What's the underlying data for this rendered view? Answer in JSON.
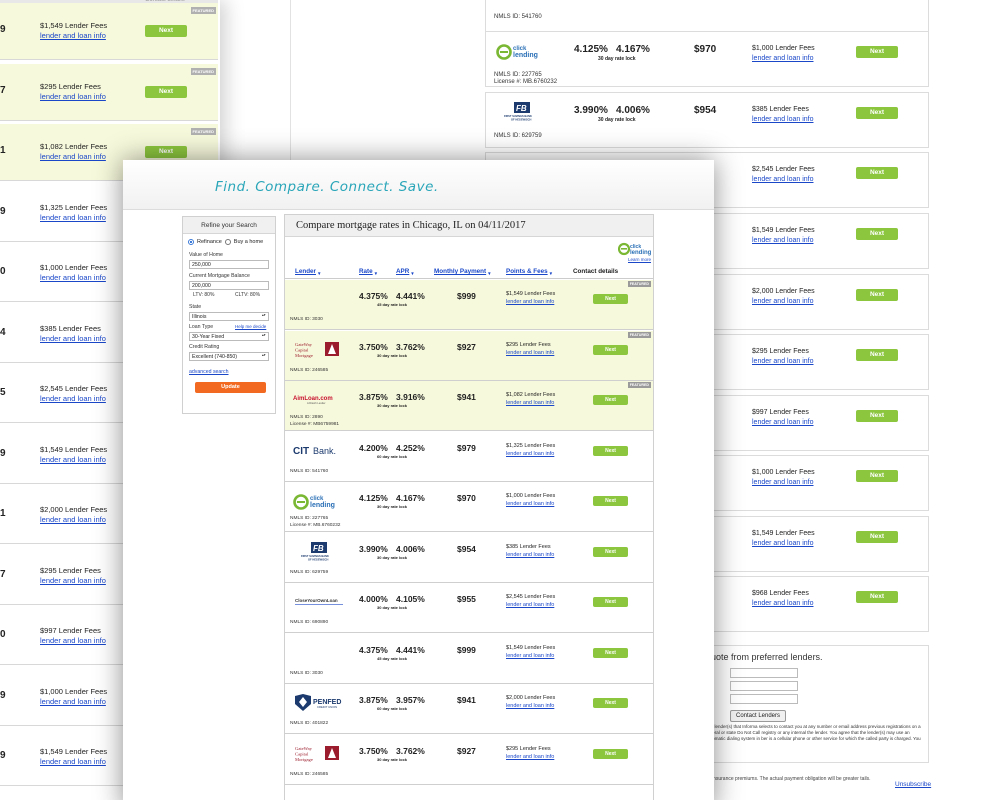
{
  "brand_colors": {
    "teal": "#2aa6b9",
    "green_button": "#8cc63f",
    "orange_button": "#f26a22",
    "link": "#1a47c8",
    "featured_bg": "#f7f9dc"
  },
  "left_page": {
    "rows": [
      {
        "num": "9",
        "fee": "$1,549 Lender Fees",
        "link": "lender and loan info",
        "next": "Next",
        "featured": true
      },
      {
        "num": "7",
        "fee": "$295 Lender Fees",
        "link": "lender and loan info",
        "next": "Next",
        "featured": true
      },
      {
        "num": "1",
        "fee": "$1,082 Lender Fees",
        "link": "lender and loan info",
        "next": "Next",
        "featured": true
      },
      {
        "num": "9",
        "fee": "$1,325 Lender Fees",
        "link": "lender and loan info",
        "next": "",
        "featured": false
      },
      {
        "num": "0",
        "fee": "$1,000 Lender Fees",
        "link": "lender and loan info",
        "next": "",
        "featured": false
      },
      {
        "num": "4",
        "fee": "$385 Lender Fees",
        "link": "lender and loan info",
        "next": "",
        "featured": false
      },
      {
        "num": "5",
        "fee": "$2,545 Lender Fees",
        "link": "lender and loan info",
        "next": "",
        "featured": false
      },
      {
        "num": "9",
        "fee": "$1,549 Lender Fees",
        "link": "lender and loan info",
        "next": "",
        "featured": false
      },
      {
        "num": "1",
        "fee": "$2,000 Lender Fees",
        "link": "lender and loan info",
        "next": "",
        "featured": false
      },
      {
        "num": "7",
        "fee": "$295 Lender Fees",
        "link": "lender and loan info",
        "next": "",
        "featured": false
      },
      {
        "num": "0",
        "fee": "$997 Lender Fees",
        "link": "lender and loan info",
        "next": "",
        "featured": false
      },
      {
        "num": "9",
        "fee": "$1,000 Lender Fees",
        "link": "lender and loan info",
        "next": "",
        "featured": false
      },
      {
        "num": "9",
        "fee": "$1,549 Lender Fees",
        "link": "lender and loan info",
        "next": "",
        "featured": false
      }
    ],
    "featured_tag": "FEATURED",
    "header_right": "Contact details"
  },
  "right_page": {
    "rows": [
      {
        "nmls": "NMLS ID: 541760",
        "rate": "",
        "apr": "",
        "lock": "",
        "pay": "",
        "fee": "",
        "link": "",
        "next": "",
        "license": "",
        "logo": ""
      },
      {
        "nmls": "NMLS ID: 227765",
        "license": "License #: MB.6760232",
        "rate": "4.125%",
        "apr": "4.167%",
        "lock": "30 day rate lock",
        "pay": "$970",
        "fee": "$1,000 Lender Fees",
        "link": "lender and loan info",
        "next": "Next",
        "logo": "eclick"
      },
      {
        "nmls": "NMLS ID: 629759",
        "license": "",
        "rate": "3.990%",
        "apr": "4.006%",
        "lock": "30 day rate lock",
        "pay": "$954",
        "fee": "$385 Lender Fees",
        "link": "lender and loan info",
        "next": "Next",
        "logo": "fsb"
      },
      {
        "nmls": "",
        "license": "",
        "rate": "",
        "apr": "",
        "lock": "",
        "pay": "",
        "fee": "$2,545 Lender Fees",
        "link": "lender and loan info",
        "next": "Next",
        "logo": ""
      },
      {
        "nmls": "",
        "license": "",
        "rate": "",
        "apr": "",
        "lock": "",
        "pay": "",
        "fee": "$1,549 Lender Fees",
        "link": "lender and loan info",
        "next": "Next",
        "logo": ""
      },
      {
        "nmls": "",
        "license": "",
        "rate": "",
        "apr": "",
        "lock": "",
        "pay": "",
        "fee": "$2,000 Lender Fees",
        "link": "lender and loan info",
        "next": "Next",
        "logo": ""
      },
      {
        "nmls": "",
        "license": "",
        "rate": "",
        "apr": "",
        "lock": "",
        "pay": "",
        "fee": "$295 Lender Fees",
        "link": "lender and loan info",
        "next": "Next",
        "logo": ""
      },
      {
        "nmls": "",
        "license": "",
        "rate": "",
        "apr": "",
        "lock": "",
        "pay": "",
        "fee": "$997 Lender Fees",
        "link": "lender and loan info",
        "next": "Next",
        "logo": ""
      },
      {
        "nmls": "",
        "license": "",
        "rate": "",
        "apr": "",
        "lock": "",
        "pay": "",
        "fee": "$1,000 Lender Fees",
        "link": "lender and loan info",
        "next": "Next",
        "logo": ""
      },
      {
        "nmls": "",
        "license": "",
        "rate": "",
        "apr": "",
        "lock": "",
        "pay": "",
        "fee": "$1,549 Lender Fees",
        "link": "lender and loan info",
        "next": "Next",
        "logo": ""
      },
      {
        "nmls": "",
        "license": "",
        "rate": "",
        "apr": "",
        "lock": "",
        "pay": "",
        "fee": "$968 Lender Fees",
        "link": "lender and loan info",
        "next": "Next",
        "logo": ""
      }
    ],
    "quote": {
      "title": "quote from preferred lenders.",
      "button": "Contact Lenders",
      "legal": "rize lender(s) that Informa selects to contact you at any number or email address previous registrations on a federal or state Do Not Call registry or any internal the lender. You agree that the lender(s) may use an automatic dialing system in ber is a cellular phone or other service for which the called party is charged. You"
    },
    "footnote": "nd insurance premiums. The actual payment obligation will be greater tails.",
    "unsubscribe": "Unsubscribe"
  },
  "front": {
    "tagline": "Find. Compare. Connect. Save.",
    "refine": {
      "title": "Refine your Search",
      "refinance": "Refinance",
      "buy": "Buy a home",
      "home_value_label": "Value of Home",
      "home_value": "250,000",
      "balance_label": "Current Mortgage Balance",
      "balance": "200,000",
      "ltv": "LTV: 80%",
      "cltv": "CLTV: 80%",
      "state_label": "State",
      "state": "Illinois",
      "loan_type_label": "Loan Type",
      "help": "Help me decide",
      "loan_type": "30-Year Fixed",
      "credit_label": "Credit Rating",
      "credit": "Excellent (740-850)",
      "advanced": "advanced search",
      "update": "Update"
    },
    "results_title": "Compare mortgage rates in Chicago, IL on 04/11/2017",
    "learn_more": "Learn more",
    "columns": {
      "lender": "Lender",
      "rate": "Rate",
      "apr": "APR",
      "payment": "Monthly Payment",
      "points": "Points & Fees",
      "contact": "Contact details"
    },
    "featured_tag": "FEATURED",
    "rows": [
      {
        "logo": "",
        "nmls": "NMLS ID: 3030",
        "license": "",
        "rate": "4.375%",
        "apr": "4.441%",
        "lock": "45 day rate lock",
        "pay": "$999",
        "fee": "$1,549 Lender Fees",
        "link": "lender and loan info",
        "next": "Next",
        "featured": true
      },
      {
        "logo": "gateway",
        "nmls": "NMLS ID: 246585",
        "license": "",
        "rate": "3.750%",
        "apr": "3.762%",
        "lock": "30 day rate lock",
        "pay": "$927",
        "fee": "$295 Lender Fees",
        "link": "lender and loan info",
        "next": "Next",
        "featured": true
      },
      {
        "logo": "aimloan",
        "nmls": "NMLS ID: 2890",
        "license": "License #: MB6759981",
        "rate": "3.875%",
        "apr": "3.916%",
        "lock": "30 day rate lock",
        "pay": "$941",
        "fee": "$1,082 Lender Fees",
        "link": "lender and loan info",
        "next": "Next",
        "featured": true
      },
      {
        "logo": "cit",
        "nmls": "NMLS ID: 541760",
        "license": "",
        "rate": "4.200%",
        "apr": "4.252%",
        "lock": "60 day rate lock",
        "pay": "$979",
        "fee": "$1,325 Lender Fees",
        "link": "lender and loan info",
        "next": "Next",
        "featured": false
      },
      {
        "logo": "eclick",
        "nmls": "NMLS ID: 227765",
        "license": "License #: MB.6760232",
        "rate": "4.125%",
        "apr": "4.167%",
        "lock": "30 day rate lock",
        "pay": "$970",
        "fee": "$1,000 Lender Fees",
        "link": "lender and loan info",
        "next": "Next",
        "featured": false
      },
      {
        "logo": "fsb",
        "nmls": "NMLS ID: 629759",
        "license": "",
        "rate": "3.990%",
        "apr": "4.006%",
        "lock": "30 day rate lock",
        "pay": "$954",
        "fee": "$385 Lender Fees",
        "link": "lender and loan info",
        "next": "Next",
        "featured": false
      },
      {
        "logo": "closeyourown",
        "nmls": "NMLS ID: 690890",
        "license": "",
        "rate": "4.000%",
        "apr": "4.105%",
        "lock": "30 day rate lock",
        "pay": "$955",
        "fee": "$2,545 Lender Fees",
        "link": "lender and loan info",
        "next": "Next",
        "featured": false
      },
      {
        "logo": "",
        "nmls": "NMLS ID: 3030",
        "license": "",
        "rate": "4.375%",
        "apr": "4.441%",
        "lock": "45 day rate lock",
        "pay": "$999",
        "fee": "$1,549 Lender Fees",
        "link": "lender and loan info",
        "next": "Next",
        "featured": false
      },
      {
        "logo": "penfed",
        "nmls": "NMLS ID: 401822",
        "license": "",
        "rate": "3.875%",
        "apr": "3.957%",
        "lock": "60 day rate lock",
        "pay": "$941",
        "fee": "$2,000 Lender Fees",
        "link": "lender and loan info",
        "next": "Next",
        "featured": false
      },
      {
        "logo": "gateway",
        "nmls": "NMLS ID: 246585",
        "license": "",
        "rate": "3.750%",
        "apr": "3.762%",
        "lock": "30 day rate lock",
        "pay": "$927",
        "fee": "$295 Lender Fees",
        "link": "lender and loan info",
        "next": "Next",
        "featured": false
      }
    ],
    "logo_text": {
      "gateway": "GateWay Capital Mortgage",
      "aimloan": "AimLoan.com",
      "aimloan_sub": "A Ditech Lender",
      "cit": "CIT Bank.",
      "eclick": "eclick lending",
      "fsb": "FIRST SAVINGS BANK OF HEGEWISCH",
      "closeyourown": "CloseYourOwnLoan",
      "penfed": "PENFED",
      "penfed_sub": "CREDIT UNION"
    }
  }
}
